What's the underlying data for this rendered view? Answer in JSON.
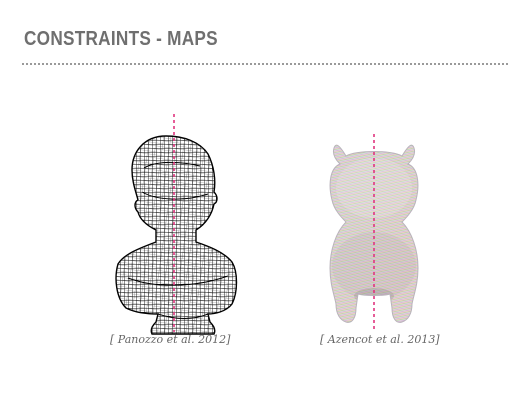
{
  "slide": {
    "title": "CONSTRAINTS - MAPS",
    "colors": {
      "title": "#6f6f6f",
      "rule": "#9a9a9a",
      "axis": "#e0357f"
    }
  },
  "figures": [
    {
      "caption": "[ Panozzo et al. 2012]",
      "subject": "bust-quad-mesh"
    },
    {
      "caption": "[ Azencot et al. 2013]",
      "subject": "cow-streamlines"
    }
  ]
}
